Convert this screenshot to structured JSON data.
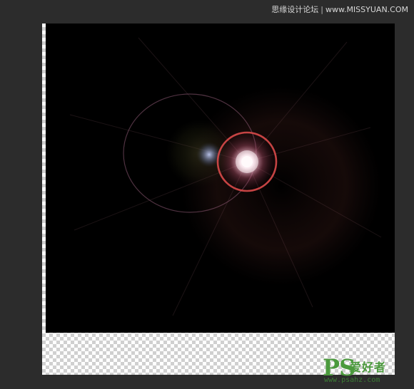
{
  "watermark": {
    "site_name": "思缘设计论坛",
    "site_url": "www.MISSYUAN.COM"
  },
  "logo": {
    "ps_text": "PS",
    "cn_text": "爱好者",
    "url_text": "www.psahz.com"
  },
  "colors": {
    "background": "#2c2c2c",
    "canvas_black": "#000000",
    "flare_core": "#ffffff",
    "flare_ring": "#d94a4a",
    "logo_green": "#4b9a3d"
  },
  "icons": {
    "lens_flare": "lens-flare-icon",
    "checkerboard": "transparency-checkerboard"
  }
}
